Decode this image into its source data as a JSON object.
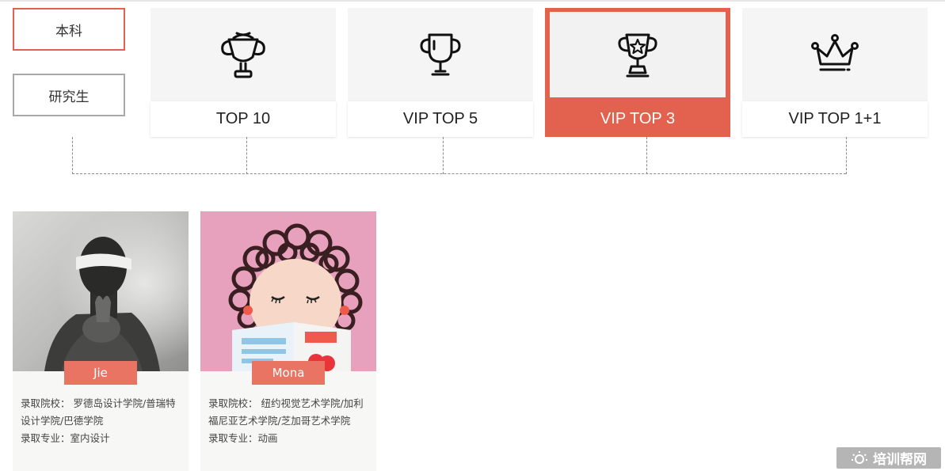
{
  "levels": {
    "active": "本科",
    "inactive": "研究生"
  },
  "tiers": [
    {
      "label": "TOP 10",
      "icon": "trophy-laurel-icon",
      "selected": false
    },
    {
      "label": "VIP TOP 5",
      "icon": "trophy-cup-icon",
      "selected": false
    },
    {
      "label": "VIP TOP 3",
      "icon": "trophy-star-icon",
      "selected": true
    },
    {
      "label": "VIP TOP 1+1",
      "icon": "crown-icon",
      "selected": false
    }
  ],
  "students": [
    {
      "name": "Jie",
      "school_line": "录取院校： 罗德岛设计学院/普瑞特设计学院/巴德学院",
      "major_line": "录取专业：室内设计"
    },
    {
      "name": "Mona",
      "school_line": "录取院校： 纽约视觉艺术学院/加利福尼亚艺术学院/芝加哥艺术学院",
      "major_line": "录取专业：动画"
    }
  ],
  "watermark": "培训帮网",
  "colors": {
    "accent": "#e3624f",
    "name_tag": "#ea7464",
    "card_bg": "#f7f7f5",
    "tile_bg": "#f5f5f5"
  }
}
